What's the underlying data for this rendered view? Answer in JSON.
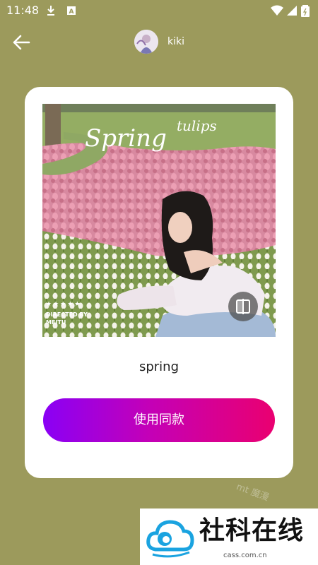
{
  "status_bar": {
    "time": "11:48",
    "left_icons": [
      "download-icon",
      "a-notification-icon"
    ],
    "right_icons": [
      "wifi-icon",
      "signal-icon",
      "battery-icon"
    ]
  },
  "header": {
    "back_icon": "arrow-left-icon",
    "username": "kiki"
  },
  "template": {
    "preview_text_spring": "Spring",
    "preview_text_tulips": "tulips",
    "rating_stars": "★★★★★",
    "directed_by": "DIRECTED BY",
    "director_name": "MEITU",
    "compare_icon": "compare-split-icon",
    "name": "spring"
  },
  "actions": {
    "use_same_label": "使用同款"
  },
  "watermark": {
    "text": "mt 魔漫"
  },
  "ad": {
    "title": "社科在线",
    "url": "cass.com.cn"
  },
  "colors": {
    "background": "#9c9a5c",
    "button_gradient_start": "#8a00f5",
    "button_gradient_end": "#ea0070"
  }
}
